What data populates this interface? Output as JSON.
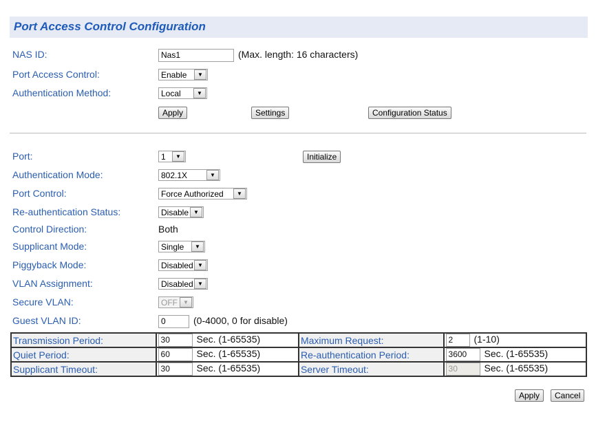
{
  "title": "Port Access Control Configuration",
  "global": {
    "nas_id_label": "NAS ID:",
    "nas_id_value": "Nas1",
    "nas_id_hint": "(Max. length: 16 characters)",
    "pac_label": "Port Access Control:",
    "pac_value": "Enable",
    "auth_method_label": "Authentication Method:",
    "auth_method_value": "Local",
    "apply": "Apply",
    "settings": "Settings",
    "config_status": "Configuration Status"
  },
  "port": {
    "port_label": "Port:",
    "port_value": "1",
    "initialize": "Initialize",
    "auth_mode_label": "Authentication Mode:",
    "auth_mode_value": "802.1X",
    "port_control_label": "Port Control:",
    "port_control_value": "Force Authorized",
    "reauth_label": "Re-authentication Status:",
    "reauth_value": "Disable",
    "control_dir_label": "Control Direction:",
    "control_dir_value": "Both",
    "supplicant_mode_label": "Supplicant Mode:",
    "supplicant_mode_value": "Single",
    "piggyback_label": "Piggyback Mode:",
    "piggyback_value": "Disabled",
    "vlan_assign_label": "VLAN Assignment:",
    "vlan_assign_value": "Disabled",
    "secure_vlan_label": "Secure VLAN:",
    "secure_vlan_value": "OFF",
    "guest_vlan_label": "Guest VLAN ID:",
    "guest_vlan_value": "0",
    "guest_vlan_hint": "(0-4000, 0 for disable)"
  },
  "timers": [
    {
      "l1": "Transmission Period:",
      "v1": "30",
      "h1": "Sec. (1-65535)",
      "l2": "Maximum Request:",
      "v2": "2",
      "h2": "(1-10)"
    },
    {
      "l1": "Quiet Period:",
      "v1": "60",
      "h1": "Sec. (1-65535)",
      "l2": "Re-authentication Period:",
      "v2": "3600",
      "h2": "Sec. (1-65535)"
    },
    {
      "l1": "Supplicant Timeout:",
      "v1": "30",
      "h1": "Sec. (1-65535)",
      "l2": "Server Timeout:",
      "v2": "30",
      "h2": "Sec. (1-65535)"
    }
  ],
  "footer": {
    "apply": "Apply",
    "cancel": "Cancel"
  }
}
